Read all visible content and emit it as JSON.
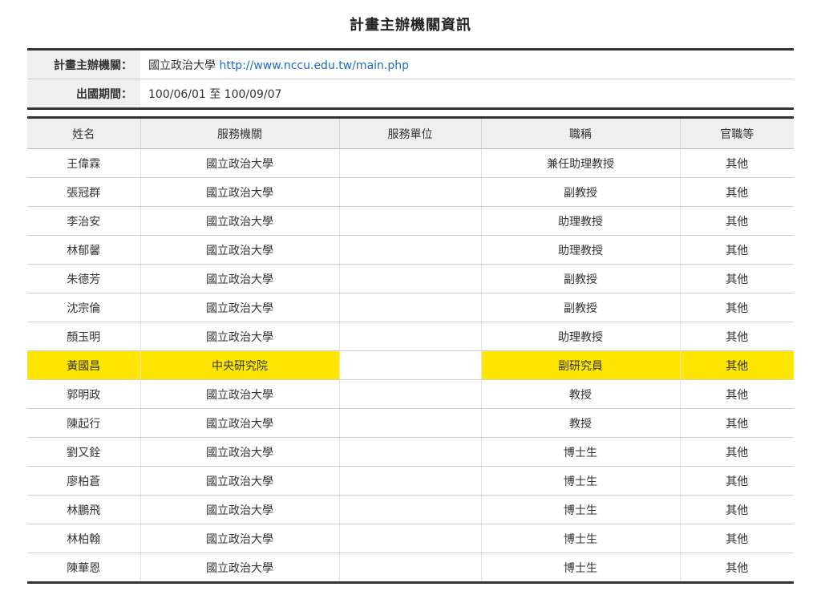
{
  "page_title": "計畫主辦機關資訊",
  "info": {
    "organizer_label": "計畫主辦機關：",
    "organizer_name": "國立政治大學",
    "organizer_url": "http://www.nccu.edu.tw/main.php",
    "period_label": "出國期間：",
    "period_value": "100/06/01 至 100/09/07"
  },
  "table": {
    "headers": [
      "姓名",
      "服務機關",
      "服務單位",
      "職稱",
      "官職等"
    ],
    "rows": [
      {
        "name": "王偉霖",
        "org": "國立政治大學",
        "unit": "",
        "title": "兼任助理教授",
        "grade": "其他"
      },
      {
        "name": "張冠群",
        "org": "國立政治大學",
        "unit": "",
        "title": "副教授",
        "grade": "其他"
      },
      {
        "name": "李治安",
        "org": "國立政治大學",
        "unit": "",
        "title": "助理教授",
        "grade": "其他"
      },
      {
        "name": "林郁馨",
        "org": "國立政治大學",
        "unit": "",
        "title": "助理教授",
        "grade": "其他"
      },
      {
        "name": "朱德芳",
        "org": "國立政治大學",
        "unit": "",
        "title": "副教授",
        "grade": "其他"
      },
      {
        "name": "沈宗倫",
        "org": "國立政治大學",
        "unit": "",
        "title": "副教授",
        "grade": "其他"
      },
      {
        "name": "顏玉明",
        "org": "國立政治大學",
        "unit": "",
        "title": "助理教授",
        "grade": "其他"
      },
      {
        "name": "黃國昌",
        "org": "中央研究院",
        "unit": "",
        "title": "副研究員",
        "grade": "其他",
        "highlight": true
      },
      {
        "name": "郭明政",
        "org": "國立政治大學",
        "unit": "",
        "title": "教授",
        "grade": "其他"
      },
      {
        "name": "陳起行",
        "org": "國立政治大學",
        "unit": "",
        "title": "教授",
        "grade": "其他"
      },
      {
        "name": "劉又銓",
        "org": "國立政治大學",
        "unit": "",
        "title": "博士生",
        "grade": "其他"
      },
      {
        "name": "廖柏蒼",
        "org": "國立政治大學",
        "unit": "",
        "title": "博士生",
        "grade": "其他"
      },
      {
        "name": "林鵬飛",
        "org": "國立政治大學",
        "unit": "",
        "title": "博士生",
        "grade": "其他"
      },
      {
        "name": "林柏翰",
        "org": "國立政治大學",
        "unit": "",
        "title": "博士生",
        "grade": "其他"
      },
      {
        "name": "陳華恩",
        "org": "國立政治大學",
        "unit": "",
        "title": "博士生",
        "grade": "其他"
      }
    ]
  },
  "colors": {
    "highlight": "#ffe600",
    "link": "#1a6cc0"
  }
}
